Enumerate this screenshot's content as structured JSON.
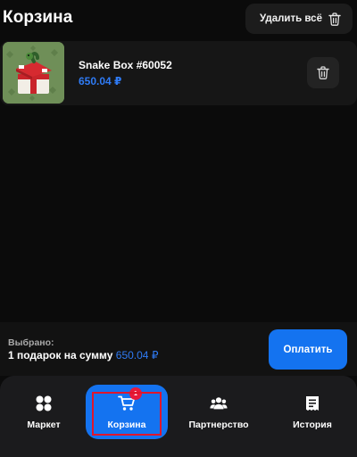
{
  "header": {
    "title": "Корзина",
    "clear_all_label": "Удалить всё"
  },
  "cart": {
    "items": [
      {
        "name": "Snake Box #60052",
        "price": "650.04 ₽",
        "thumbnail": "gift-box-icon"
      }
    ]
  },
  "summary": {
    "selected_label": "Выбрано:",
    "selected_text": "1 подарок на сумму",
    "selected_sum": "650.04 ₽",
    "pay_label": "Оплатить"
  },
  "nav": {
    "items": [
      {
        "label": "Маркет",
        "icon": "grid-icon",
        "active": false
      },
      {
        "label": "Корзина",
        "icon": "cart-icon",
        "active": true,
        "badge": "1"
      },
      {
        "label": "Партнерство",
        "icon": "users-icon",
        "active": false
      },
      {
        "label": "История",
        "icon": "receipt-icon",
        "active": false
      }
    ]
  },
  "colors": {
    "background": "#0b0b0b",
    "accent": "#1473f0",
    "price": "#2f7bf5",
    "badge": "#e81a3b",
    "highlight": "#e0162b"
  }
}
